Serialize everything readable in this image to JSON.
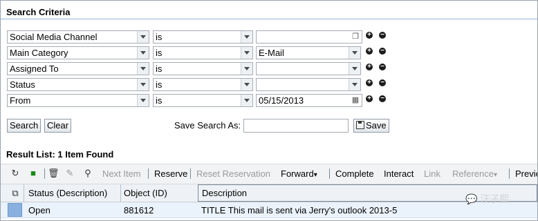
{
  "search_criteria": {
    "title": "Search Criteria",
    "rows": [
      {
        "field": "Social Media Channel",
        "operator": "is",
        "value": "",
        "value_icon": "value-help-icon",
        "has_dropdown": false
      },
      {
        "field": "Main Category",
        "operator": "is",
        "value": "E-Mail",
        "value_icon": "",
        "has_dropdown": true
      },
      {
        "field": "Assigned To",
        "operator": "is",
        "value": "",
        "value_icon": "",
        "has_dropdown": true
      },
      {
        "field": "Status",
        "operator": "is",
        "value": "",
        "value_icon": "",
        "has_dropdown": true
      },
      {
        "field": "From",
        "operator": "is",
        "value": "05/15/2013",
        "value_icon": "calendar-icon",
        "has_dropdown": false
      }
    ],
    "add_symbol": "+",
    "remove_symbol": "−"
  },
  "actions": {
    "search_label": "Search",
    "clear_label": "Clear",
    "save_search_label": "Save Search As:",
    "save_search_value": "",
    "save_label": "Save"
  },
  "result": {
    "title": "Result List: 1 Item Found",
    "toolbar": {
      "next_item": "Next Item",
      "reserve": "Reserve",
      "reset_reservation": "Reset Reservation",
      "forward": "Forward",
      "complete": "Complete",
      "interact": "Interact",
      "link": "Link",
      "reference": "Reference",
      "preview": "Previe",
      "dropdown_mark": "▾"
    },
    "columns": {
      "status": "Status (Description)",
      "object_id": "Object (ID)",
      "description": "Description"
    },
    "rows": [
      {
        "status": "Open",
        "object_id": "881612",
        "description": "TITLE This mail is sent via Jerry's outlook 2013-5"
      }
    ]
  },
  "watermark": "汪子熙",
  "colors": {
    "title_rule": "#8fb3d9",
    "toolbar_bg": "#f1f3f5",
    "row_selected": "#8ab0e0",
    "disabled_text": "#9a9a9a"
  }
}
